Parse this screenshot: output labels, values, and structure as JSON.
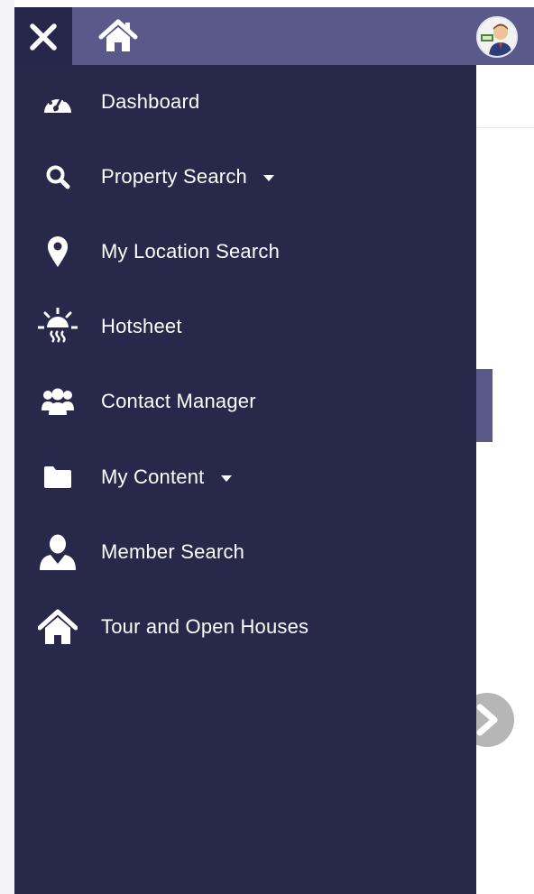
{
  "header": {
    "close_icon": "close-icon",
    "home_icon": "home-icon",
    "avatar_icon": "user-avatar"
  },
  "menu": {
    "items": [
      {
        "label": "Dashboard",
        "icon": "dashboard-gauge-icon",
        "has_caret": false
      },
      {
        "label": "Property Search",
        "icon": "search-icon",
        "has_caret": true
      },
      {
        "label": "My Location Search",
        "icon": "map-pin-icon",
        "has_caret": false
      },
      {
        "label": "Hotsheet",
        "icon": "sun-heat-icon",
        "has_caret": false
      },
      {
        "label": "Contact Manager",
        "icon": "group-icon",
        "has_caret": false
      },
      {
        "label": "My Content",
        "icon": "folder-icon",
        "has_caret": true
      },
      {
        "label": "Member Search",
        "icon": "member-icon",
        "has_caret": false
      },
      {
        "label": "Tour and Open Houses",
        "icon": "house-icon",
        "has_caret": false
      }
    ]
  },
  "colors": {
    "drawer_bg": "#27284a",
    "header_bg": "#5a598a",
    "close_bg": "#26274a",
    "text": "#ffffff",
    "arrow": "#bdbdbd"
  }
}
